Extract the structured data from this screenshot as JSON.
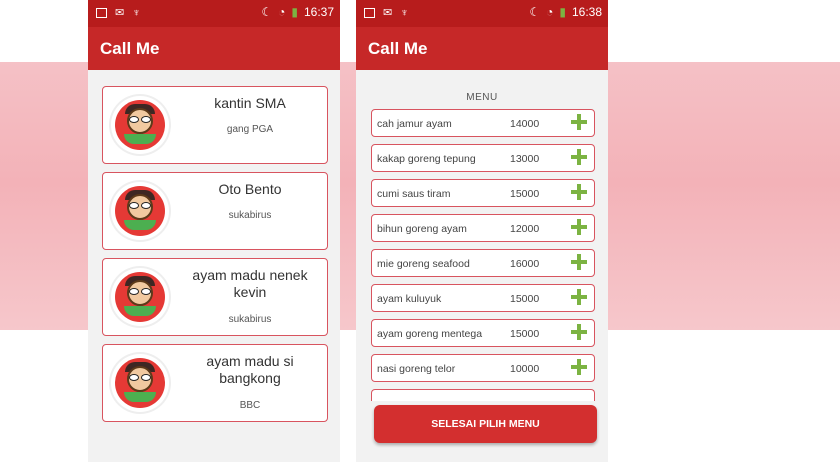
{
  "left_phone": {
    "status": {
      "time": "16:37"
    },
    "app_title": "Call Me",
    "restaurants": [
      {
        "name": "kantin SMA",
        "location": "gang PGA"
      },
      {
        "name": "Oto Bento",
        "location": "sukabirus"
      },
      {
        "name": "ayam madu nenek kevin",
        "location": "sukabirus"
      },
      {
        "name": "ayam madu si bangkong",
        "location": "BBC"
      }
    ]
  },
  "right_phone": {
    "status": {
      "time": "16:38"
    },
    "app_title": "Call Me",
    "menu_title": "MENU",
    "items": [
      {
        "name": "cah jamur ayam",
        "price": "14000"
      },
      {
        "name": "kakap goreng tepung",
        "price": "13000"
      },
      {
        "name": "cumi saus tiram",
        "price": "15000"
      },
      {
        "name": "bihun goreng ayam",
        "price": "12000"
      },
      {
        "name": "mie goreng seafood",
        "price": "16000"
      },
      {
        "name": "ayam kuluyuk",
        "price": "15000"
      },
      {
        "name": "ayam goreng mentega",
        "price": "15000"
      },
      {
        "name": "nasi goreng telor",
        "price": "10000"
      }
    ],
    "finish_button": "SELESAI PILIH MENU"
  },
  "colors": {
    "statusbar": "#b71c1c",
    "appbar": "#c62828",
    "accent": "#d8545f",
    "plus": "#7cb342"
  },
  "icons": [
    "image-icon",
    "mail-icon",
    "usb-icon",
    "moon-icon",
    "wifi-icon",
    "battery-charging-icon"
  ]
}
